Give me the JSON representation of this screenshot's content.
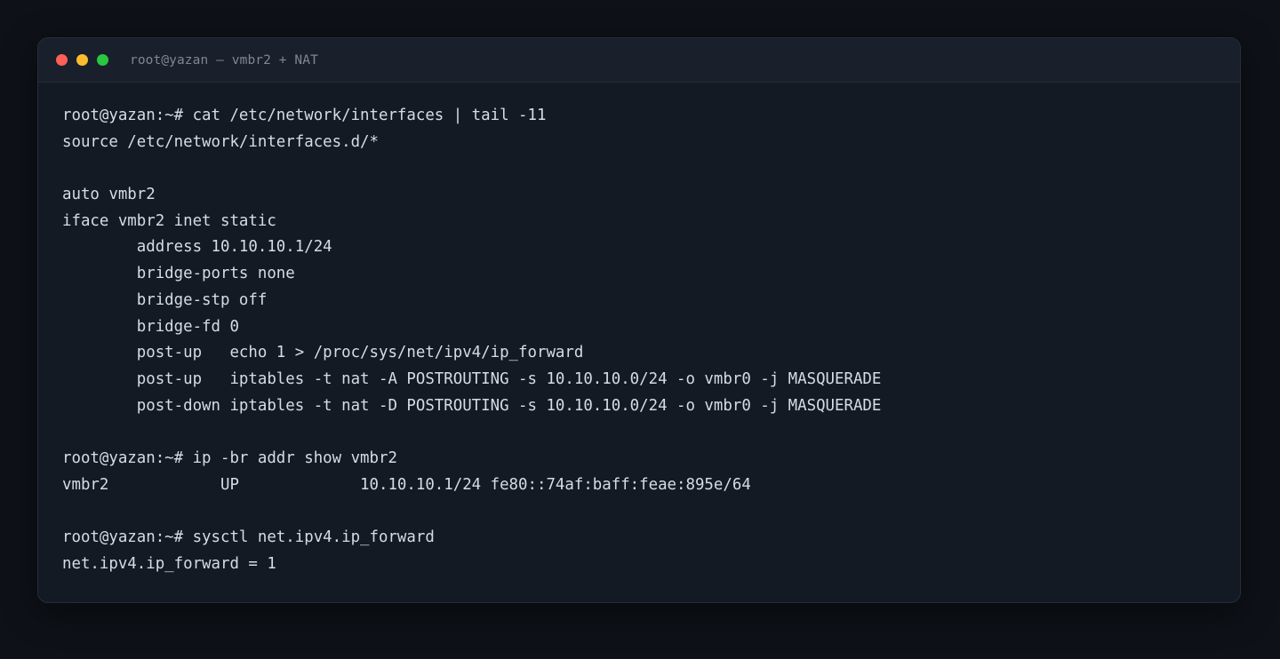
{
  "window": {
    "title": "root@yazan — vmbr2 + NAT"
  },
  "terminal": {
    "lines": [
      "root@yazan:~# cat /etc/network/interfaces | tail -11",
      "source /etc/network/interfaces.d/*",
      "",
      "auto vmbr2",
      "iface vmbr2 inet static",
      "        address 10.10.10.1/24",
      "        bridge-ports none",
      "        bridge-stp off",
      "        bridge-fd 0",
      "        post-up   echo 1 > /proc/sys/net/ipv4/ip_forward",
      "        post-up   iptables -t nat -A POSTROUTING -s 10.10.10.0/24 -o vmbr0 -j MASQUERADE",
      "        post-down iptables -t nat -D POSTROUTING -s 10.10.10.0/24 -o vmbr0 -j MASQUERADE",
      "",
      "root@yazan:~# ip -br addr show vmbr2",
      "vmbr2            UP             10.10.10.1/24 fe80::74af:baff:feae:895e/64",
      "",
      "root@yazan:~# sysctl net.ipv4.ip_forward",
      "net.ipv4.ip_forward = 1"
    ]
  },
  "colors": {
    "background": "#0e1117",
    "window": "#131a24",
    "text": "#d6dce6",
    "title_text": "#7e8796",
    "close": "#ff5f57",
    "minimize": "#febc2e",
    "maximize": "#28c840"
  }
}
